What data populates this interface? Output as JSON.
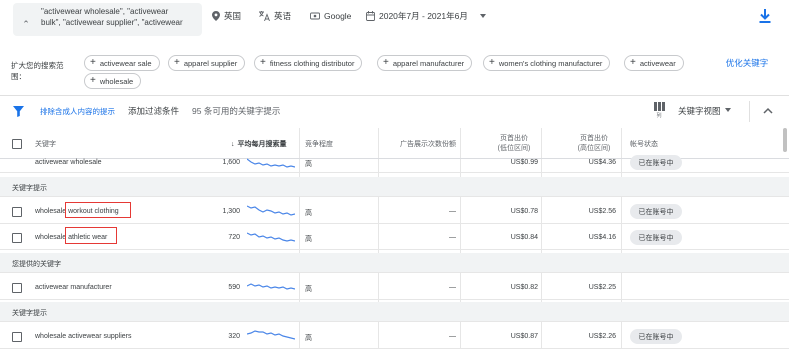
{
  "top": {
    "keywords_line1": "\"activewear wholesale\", \"activewear",
    "keywords_line2": "bulk\", \"activewear supplier\", \"activewear",
    "location": "英国",
    "language": "英语",
    "network": "Google",
    "date_range": "2020年7月 - 2021年6月"
  },
  "expand": {
    "label": "扩大您的搜索范围：",
    "chips": [
      "activewear sale",
      "apparel supplier",
      "fitness clothing distributor",
      "apparel manufacturer",
      "women's clothing manufacturer",
      "activewear",
      "wholesale"
    ],
    "optimize": "优化关键字"
  },
  "toolbar": {
    "exclude": "排除含成人内容的提示",
    "add_filter": "添加过滤条件",
    "count": "95 条可用的关键字提示",
    "columns_label": "列",
    "view": "关键字视图"
  },
  "columns": {
    "keyword": "关键字",
    "avg_monthly": "平均每月搜索量",
    "competition": "竞争程度",
    "impression_share": "广告展示次数份额",
    "bid_low_1": "页首出价",
    "bid_low_2": "(低位区间)",
    "bid_high_1": "页首出价",
    "bid_high_2": "(高位区间)",
    "account_status": "帐号状态"
  },
  "rows": [
    {
      "keyword": "activewear wholesale",
      "volume": "1,600",
      "competition": "高",
      "impression": "",
      "bid_low": "US$0.99",
      "bid_high": "US$4.36",
      "status": "已在账号中"
    }
  ],
  "group1": {
    "title": "关键字提示",
    "rows": [
      {
        "keyword_prefix": "wholesale",
        "keyword_suffix": "workout clothing",
        "volume": "1,300",
        "competition": "高",
        "impression": "—",
        "bid_low": "US$0.78",
        "bid_high": "US$2.56",
        "status": "已在账号中"
      },
      {
        "keyword_prefix": "wholesale",
        "keyword_suffix": "athletic wear",
        "volume": "720",
        "competition": "高",
        "impression": "—",
        "bid_low": "US$0.84",
        "bid_high": "US$4.16",
        "status": "已在账号中"
      }
    ]
  },
  "group2": {
    "title": "您提供的关键字",
    "rows": [
      {
        "keyword": "activewear manufacturer",
        "volume": "590",
        "competition": "高",
        "impression": "—",
        "bid_low": "US$0.82",
        "bid_high": "US$2.25",
        "status": ""
      }
    ]
  },
  "group3": {
    "title": "关键字提示",
    "rows": [
      {
        "keyword": "wholesale activewear suppliers",
        "volume": "320",
        "competition": "高",
        "impression": "—",
        "bid_low": "US$0.87",
        "bid_high": "US$2.26",
        "status": "已在账号中"
      }
    ]
  },
  "colors": {
    "accent": "#1a73e8",
    "highlight": "#e53935",
    "sparkline": "#4a86e8"
  }
}
